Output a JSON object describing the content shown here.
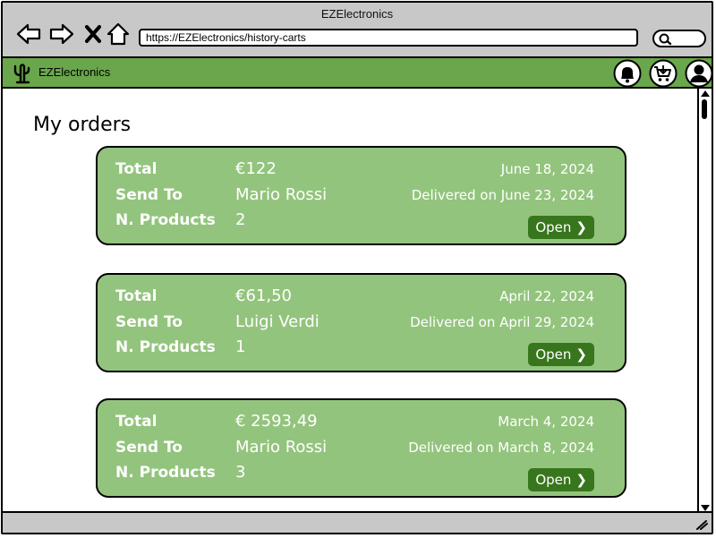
{
  "browser": {
    "window_title": "EZElectronics",
    "url": "https://EZElectronics/history-carts",
    "nav": [
      "back-icon",
      "forward-icon",
      "close-icon",
      "home-icon"
    ],
    "search_icon": "search-icon"
  },
  "app": {
    "name": "EZElectronics",
    "logo_icon": "cactus-icon",
    "header_icons": [
      "bell-icon",
      "cart-icon",
      "user-icon"
    ],
    "accent": "#6aa64b",
    "card_color": "#93c47d",
    "button_color": "#38761d"
  },
  "page": {
    "title": "My orders"
  },
  "labels": {
    "total": "Total",
    "send_to": "Send To",
    "n_products": "N. Products",
    "open": "Open"
  },
  "orders": [
    {
      "total": "€122",
      "send_to": "Mario Rossi",
      "n_products": "2",
      "date": "June 18, 2024",
      "status": "Delivered on June 23, 2024"
    },
    {
      "total": "€61,50",
      "send_to": "Luigi Verdi",
      "n_products": "1",
      "date": "April 22, 2024",
      "status": "Delivered on April 29, 2024"
    },
    {
      "total": "€ 2593,49",
      "send_to": "Mario Rossi",
      "n_products": "3",
      "date": "March 4, 2024",
      "status": "Delivered on March 8, 2024"
    }
  ]
}
